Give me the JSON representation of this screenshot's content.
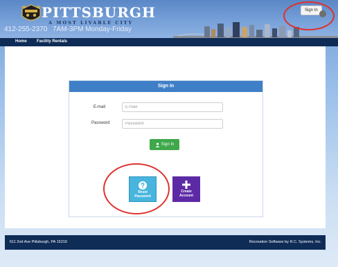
{
  "header": {
    "logo_title": "PITTSBURGH",
    "logo_subtitle": "A MOST LIVABLE CITY",
    "phone": "412-255-2370",
    "hours": "7AM-3PM Monday-Friday",
    "signin_link": "Sign In"
  },
  "nav": {
    "items": [
      "Home",
      "Facility Rentals"
    ]
  },
  "signin_form": {
    "title": "Sign In",
    "email_label": "E-mail",
    "email_placeholder": "E-mail",
    "email_value": "",
    "password_label": "Password",
    "password_placeholder": "Password",
    "password_value": "",
    "submit_label": "Sign In"
  },
  "tiles": {
    "reset_line1": "Reset",
    "reset_line2": "Password",
    "create_line1": "Create",
    "create_line2": "Account"
  },
  "footer": {
    "address": "611 2nd Ave Pittsburgh, PA 15219",
    "credit": "Recreation Software by R.C. Systems, Inc."
  },
  "colors": {
    "navbar": "#0f2c57",
    "card_header": "#3f7fc7",
    "signin_button": "#3ea84a",
    "reset_tile": "#47b5dd",
    "create_tile": "#5d2aa6",
    "annotation": "#e0302c"
  },
  "icons": [
    "city-seal-icon",
    "user-icon",
    "question-icon",
    "plus-icon",
    "user-circle-icon"
  ]
}
